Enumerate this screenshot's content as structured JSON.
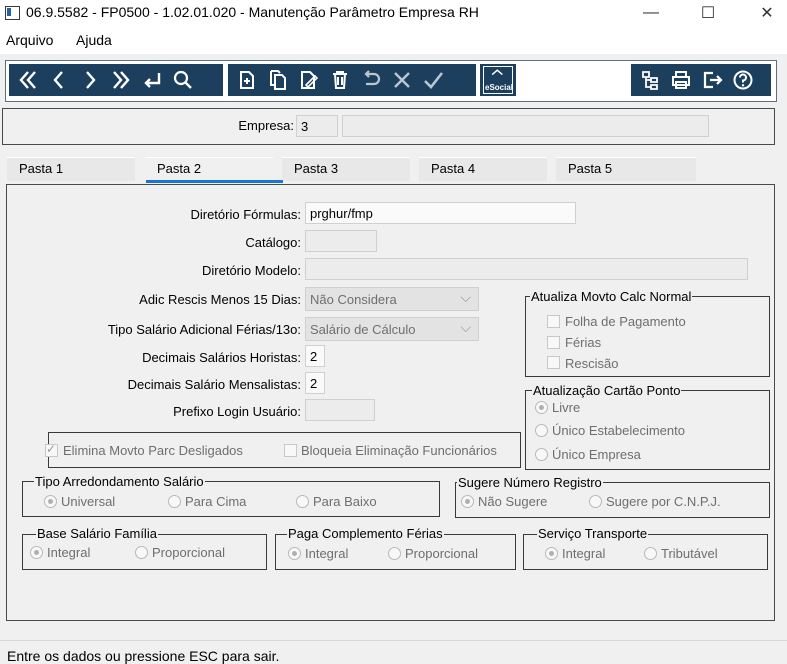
{
  "window": {
    "title": "06.9.5582 - FP0500 - 1.02.01.020 - Manutenção Parâmetro Empresa RH",
    "minimize": "—",
    "maximize": "☐",
    "close": "✕"
  },
  "menu": [
    "Arquivo",
    "Ajuda"
  ],
  "toolbar": {
    "nav": [
      "first-icon",
      "prev-icon",
      "next-icon",
      "last-icon",
      "goto-icon",
      "search-icon"
    ],
    "edit": [
      "add-icon",
      "copy-icon",
      "modify-icon",
      "delete-icon",
      "undo-icon",
      "cancel-icon",
      "confirm-icon"
    ],
    "esocial_label": "eSocial",
    "right": [
      "tree-icon",
      "print-icon",
      "exit-icon",
      "help-icon"
    ]
  },
  "empresa": {
    "label": "Empresa:",
    "code": "3",
    "name": ""
  },
  "tabs": [
    "Pasta 1",
    "Pasta 2",
    "Pasta 3",
    "Pasta 4",
    "Pasta 5"
  ],
  "active_tab": "Pasta 2",
  "form": {
    "diretorio_formulas": {
      "label": "Diretório Fórmulas:",
      "value": "prghur/fmp"
    },
    "catalogo": {
      "label": "Catálogo:",
      "value": ""
    },
    "diretorio_modelo": {
      "label": "Diretório Modelo:",
      "value": ""
    },
    "adic_rescis": {
      "label": "Adic Rescis Menos 15 Dias:",
      "value": "Não Considera"
    },
    "tipo_salario_adicional": {
      "label": "Tipo Salário Adicional Férias/13o:",
      "value": "Salário de Cálculo"
    },
    "decimais_horistas": {
      "label": "Decimais Salários Horistas:",
      "value": "2"
    },
    "decimais_mensalistas": {
      "label": "Decimais Salário Mensalistas:",
      "value": "2"
    },
    "prefixo_login": {
      "label": "Prefixo Login Usuário:",
      "value": ""
    }
  },
  "atualiza_movto": {
    "title": "Atualiza Movto Calc Normal",
    "options": [
      "Folha de Pagamento",
      "Férias",
      "Rescisão"
    ]
  },
  "atualizacao_cartao": {
    "title": "Atualização Cartão Ponto",
    "options": [
      "Livre",
      "Único Estabelecimento",
      "Único Empresa"
    ],
    "selected": "Livre"
  },
  "checks": {
    "elimina": {
      "label": "Elimina Movto Parc Desligados",
      "checked": true
    },
    "bloqueia": {
      "label": "Bloqueia Eliminação Funcionários",
      "checked": false
    }
  },
  "tipo_arredondamento": {
    "title": "Tipo Arredondamento Salário",
    "options": [
      "Universal",
      "Para Cima",
      "Para Baixo"
    ],
    "selected": "Universal"
  },
  "sugere_numero": {
    "title": "Sugere Número Registro",
    "options": [
      "Não Sugere",
      "Sugere por C.N.P.J."
    ],
    "selected": "Não Sugere"
  },
  "base_salario_familia": {
    "title": "Base Salário Família",
    "options": [
      "Integral",
      "Proporcional"
    ],
    "selected": "Integral"
  },
  "paga_complemento": {
    "title": "Paga Complemento Férias",
    "options": [
      "Integral",
      "Proporcional"
    ],
    "selected": "Integral"
  },
  "servico_transporte": {
    "title": "Serviço Transporte",
    "options": [
      "Integral",
      "Tributável"
    ],
    "selected": "Integral"
  },
  "status": "Entre os dados ou pressione ESC para sair."
}
